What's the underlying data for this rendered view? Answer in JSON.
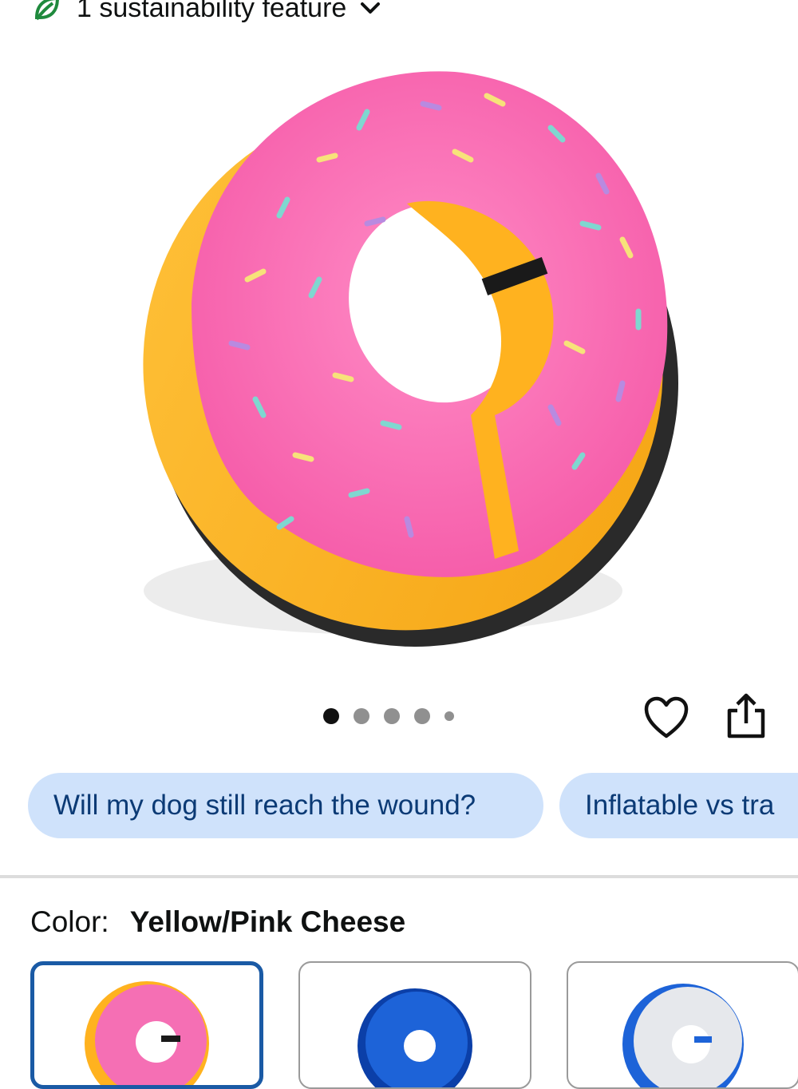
{
  "sustainability": {
    "label": "1 sustainability feature"
  },
  "gallery": {
    "total_images": 5,
    "active_index": 0
  },
  "chips": [
    {
      "label": "Will my dog still reach the wound?"
    },
    {
      "label": "Inflatable vs tra"
    }
  ],
  "color": {
    "label": "Color:",
    "value": "Yellow/Pink Cheese"
  },
  "swatches": [
    {
      "name": "yellow-pink",
      "selected": true
    },
    {
      "name": "blue",
      "selected": false
    },
    {
      "name": "white-blue",
      "selected": false
    }
  ],
  "colors": {
    "accent_blue": "#1a5aa5",
    "chip_bg": "#cfe2fb",
    "chip_text": "#0b3a75",
    "leaf_green": "#1f8a3d"
  }
}
